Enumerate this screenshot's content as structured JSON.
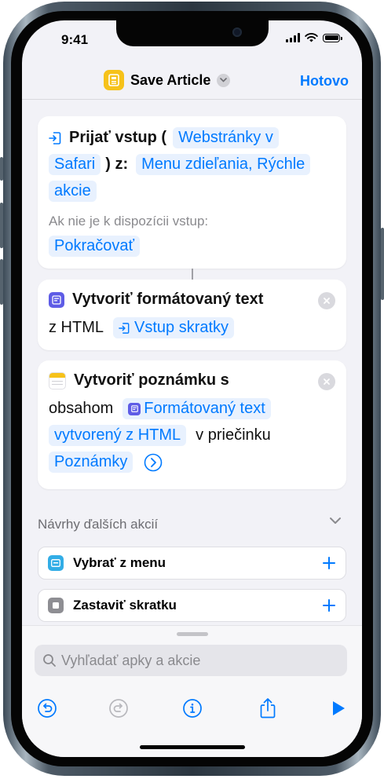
{
  "status_bar": {
    "time": "9:41"
  },
  "nav": {
    "title": "Save Article",
    "done_label": "Hotovo"
  },
  "actions": [
    {
      "title": "Prijať vstup (",
      "type_token_1": "Webstránky v",
      "type_token_2": "Safari",
      "from_label": ") z:",
      "source_token_1": "Menu zdieľania, Rýchle",
      "source_token_2": "akcie",
      "fallback_label": "Ak nie je k dispozícii vstup:",
      "fallback_value": "Pokračovať"
    },
    {
      "title": "Vytvoriť formátovaný text",
      "title_2": "z HTML",
      "input_token": "Vstup skratky"
    },
    {
      "title": "Vytvoriť poznámku s",
      "title_2": "obsahom",
      "content_token_1": "Formátovaný text",
      "content_token_2": "vytvorený z HTML",
      "folder_label": "v priečinku",
      "folder_token": "Poznámky"
    }
  ],
  "suggestions": {
    "heading": "Návrhy ďalších akcií",
    "items": [
      {
        "label": "Vybrať z menu"
      },
      {
        "label": "Zastaviť skratku"
      }
    ]
  },
  "search": {
    "placeholder": "Vyhľadať apky a akcie"
  },
  "colors": {
    "accent": "#007aff",
    "app_icon": "#f6c21a",
    "card_bg": "#ffffff",
    "screen_bg": "#f2f2f7"
  }
}
